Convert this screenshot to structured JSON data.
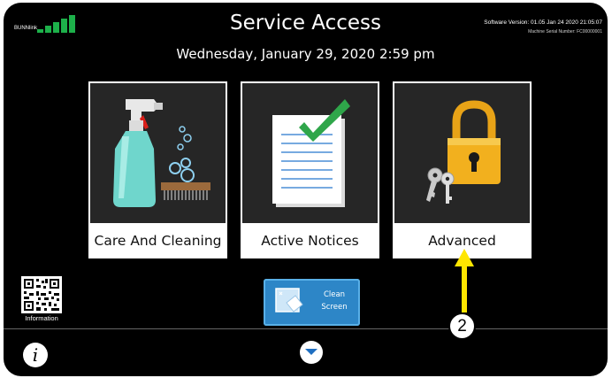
{
  "header": {
    "network_label": "BUNNlink",
    "title": "Service Access",
    "software_version": "Software Version: 01.05 Jan 24 2020 21:05:07",
    "serial_number": "Machine Serial Number: FC00000001"
  },
  "datetime": "Wednesday, January 29, 2020 2:59 pm",
  "tiles": [
    {
      "label": "Care And Cleaning",
      "icon": "spray-bottle-brush-icon"
    },
    {
      "label": "Active Notices",
      "icon": "checklist-document-icon"
    },
    {
      "label": "Advanced",
      "icon": "padlock-keys-icon"
    }
  ],
  "information": {
    "label": "Information",
    "icon": "qr-code-icon"
  },
  "clean_screen": {
    "line1": "Clean",
    "line2": "Screen",
    "icon": "wipe-screen-icon"
  },
  "footer": {
    "info_icon_glyph": "i"
  },
  "annotation": {
    "callout_number": "2",
    "arrow_color": "#ffe600"
  },
  "colors": {
    "signal_green": "#1db04a",
    "button_blue": "#2d86c7",
    "check_green": "#2fa64a",
    "lock_gold": "#e8a317"
  }
}
